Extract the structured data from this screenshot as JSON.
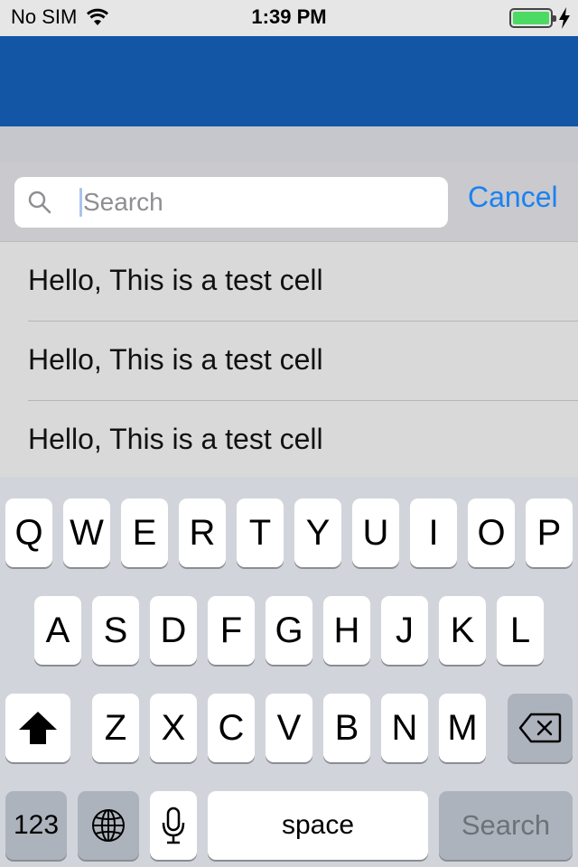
{
  "status_bar": {
    "carrier": "No SIM",
    "time": "1:39 PM",
    "battery_level": 1.0,
    "icons": [
      "wifi-icon",
      "battery-icon",
      "charging-bolt-icon"
    ]
  },
  "search": {
    "placeholder": "Search",
    "value": "",
    "cancel_label": "Cancel"
  },
  "cells": [
    {
      "label": "Hello, This is a test cell"
    },
    {
      "label": "Hello, This is a test cell"
    },
    {
      "label": "Hello, This is a test cell"
    }
  ],
  "keyboard": {
    "row1": [
      "Q",
      "W",
      "E",
      "R",
      "T",
      "Y",
      "U",
      "I",
      "O",
      "P"
    ],
    "row2": [
      "A",
      "S",
      "D",
      "F",
      "G",
      "H",
      "J",
      "K",
      "L"
    ],
    "row3": [
      "Z",
      "X",
      "C",
      "V",
      "B",
      "N",
      "M"
    ],
    "numbers_label": "123",
    "space_label": "space",
    "return_label": "Search",
    "icons": [
      "shift-icon",
      "delete-icon",
      "globe-icon",
      "microphone-icon"
    ]
  },
  "colors": {
    "nav_bar": "#1256a5",
    "accent": "#1a82f0",
    "battery": "#4cd964"
  }
}
